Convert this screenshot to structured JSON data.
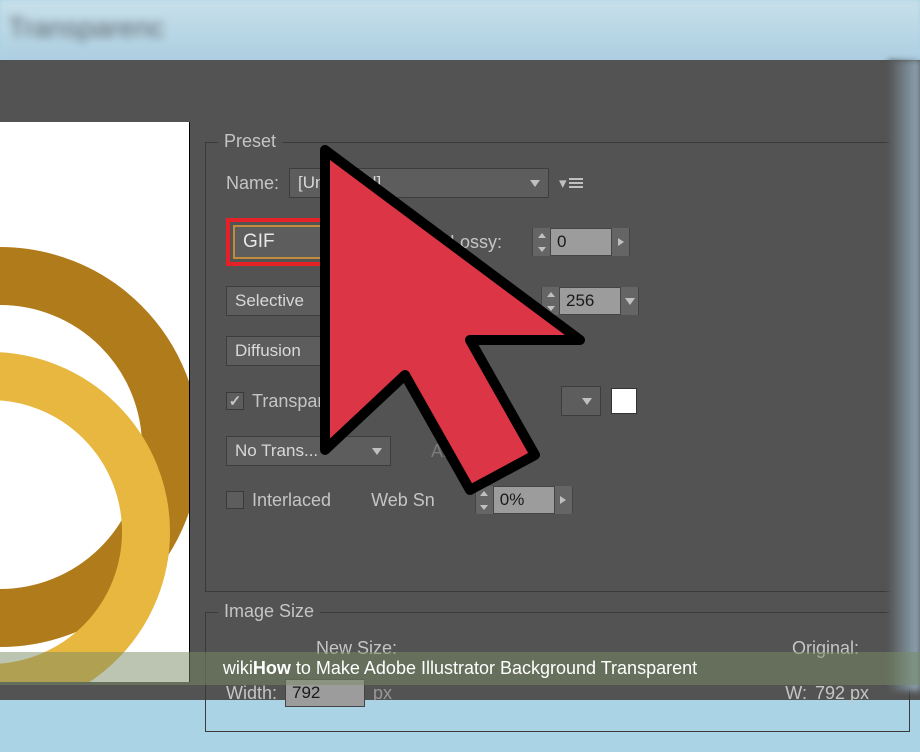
{
  "window": {
    "blurred_title": "Transparenc"
  },
  "preset": {
    "legend": "Preset",
    "name_label": "Name:",
    "name_value": "[Unnamed]",
    "format_value": "GIF",
    "lossy_label": "Lossy:",
    "lossy_value": "0",
    "reduction_value": "Selective",
    "colors_value": "256",
    "dither_value": "Diffusion",
    "transparency_label": "Transparency",
    "transparency_checked": true,
    "transparency_dither_value": "No Trans...",
    "amount_label_frag": "Am",
    "interlaced_label": "Interlaced",
    "interlaced_checked": false,
    "websnap_label": "Web Sn",
    "websnap_value": "0%"
  },
  "image_size": {
    "legend": "Image Size",
    "new_size_label": "New Size:",
    "original_label": "Original:",
    "width_label": "Width:",
    "width_value": "792",
    "width_unit": "px",
    "orig_w_label": "W:",
    "orig_w_value": "792 px"
  },
  "watermark": {
    "prefix": "wiki",
    "bold": "How",
    "rest": " to Make Adobe Illustrator Background Transparent"
  }
}
